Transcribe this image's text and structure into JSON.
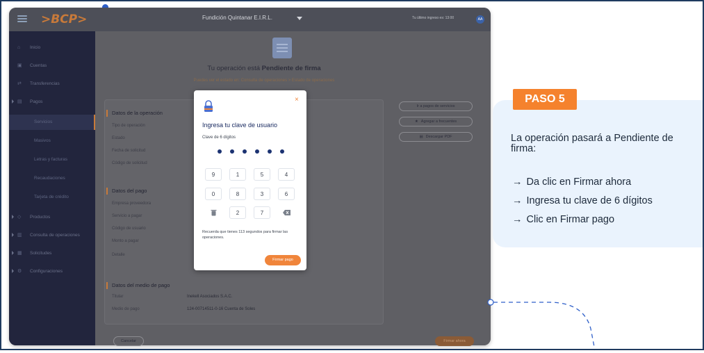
{
  "header": {
    "logo_left": ">BCP",
    "logo_right": ">",
    "company": "Fundición Quintanar E.I.R.L.",
    "last_login": "Tu último ingreso es: 13:00",
    "avatar_initials": "AA"
  },
  "sidebar": {
    "items": [
      {
        "label": "Inicio",
        "icon": "home-icon"
      },
      {
        "label": "Cuentas",
        "icon": "wallet-icon"
      },
      {
        "label": "Transferencias",
        "icon": "transfer-icon"
      },
      {
        "label": "Pagos",
        "icon": "payments-icon"
      },
      {
        "label": "Productos",
        "icon": "products-icon"
      },
      {
        "label": "Consulta de operaciones",
        "icon": "search-doc-icon"
      },
      {
        "label": "Solicitudes",
        "icon": "requests-icon"
      },
      {
        "label": "Configuraciones",
        "icon": "settings-icon"
      }
    ],
    "subitems": [
      "Servicios",
      "Masivos",
      "Letras y facturas",
      "Recaudaciones",
      "Tarjeta de crédito"
    ]
  },
  "main": {
    "title_prefix": "Tu operación está",
    "title_status": "Pendiente de firma",
    "subtitle": "Puedes ver el estado en: Consulta de operaciones > Estado de operaciones",
    "sections": {
      "operation": {
        "title": "Datos de la operación",
        "fields": [
          "Tipo de operación",
          "Estado",
          "Fecha de solicitud",
          "Código de solicitud"
        ]
      },
      "payment": {
        "title": "Datos del pago",
        "fields": [
          "Empresa proveedora",
          "Servicio a pagar",
          "Código de usuario",
          "Monto a pagar",
          "Detalle"
        ]
      },
      "method": {
        "title": "Datos del medio de pago",
        "fields": [
          "Titular",
          "Medio de pago"
        ],
        "values": [
          "Inekell Asociados S.A.C.",
          "124-00714511-0-16 Cuenta de Soles"
        ]
      }
    },
    "side_buttons": [
      "Ir a pagos de servicios",
      "Agregar a frecuentes",
      "Descargar PDF"
    ],
    "cancel_label": "Cancelar",
    "sign_now_label": "Firmar ahora"
  },
  "modal": {
    "title": "Ingresa tu clave de usuario",
    "label": "Clave de 6 dígitos",
    "close": "×",
    "keys": [
      "9",
      "1",
      "5",
      "4",
      "0",
      "8",
      "3",
      "6",
      "",
      "2",
      "7",
      ""
    ],
    "note": "Recuerda que tienes 113 segundos para firmar las operaciones.",
    "pay_button": "Firmar pago"
  },
  "panel": {
    "badge": "PASO 5",
    "text": "La operación pasará a Pendiente de firma:",
    "steps": [
      "Da clic en Firmar ahora",
      "Ingresa tu clave de 6 dígitos",
      "Clic en Firmar pago"
    ],
    "arrow": "→"
  },
  "colors": {
    "accent": "#f5822d",
    "panel_bg": "#eaf3fd",
    "navy": "#1a2b61"
  }
}
